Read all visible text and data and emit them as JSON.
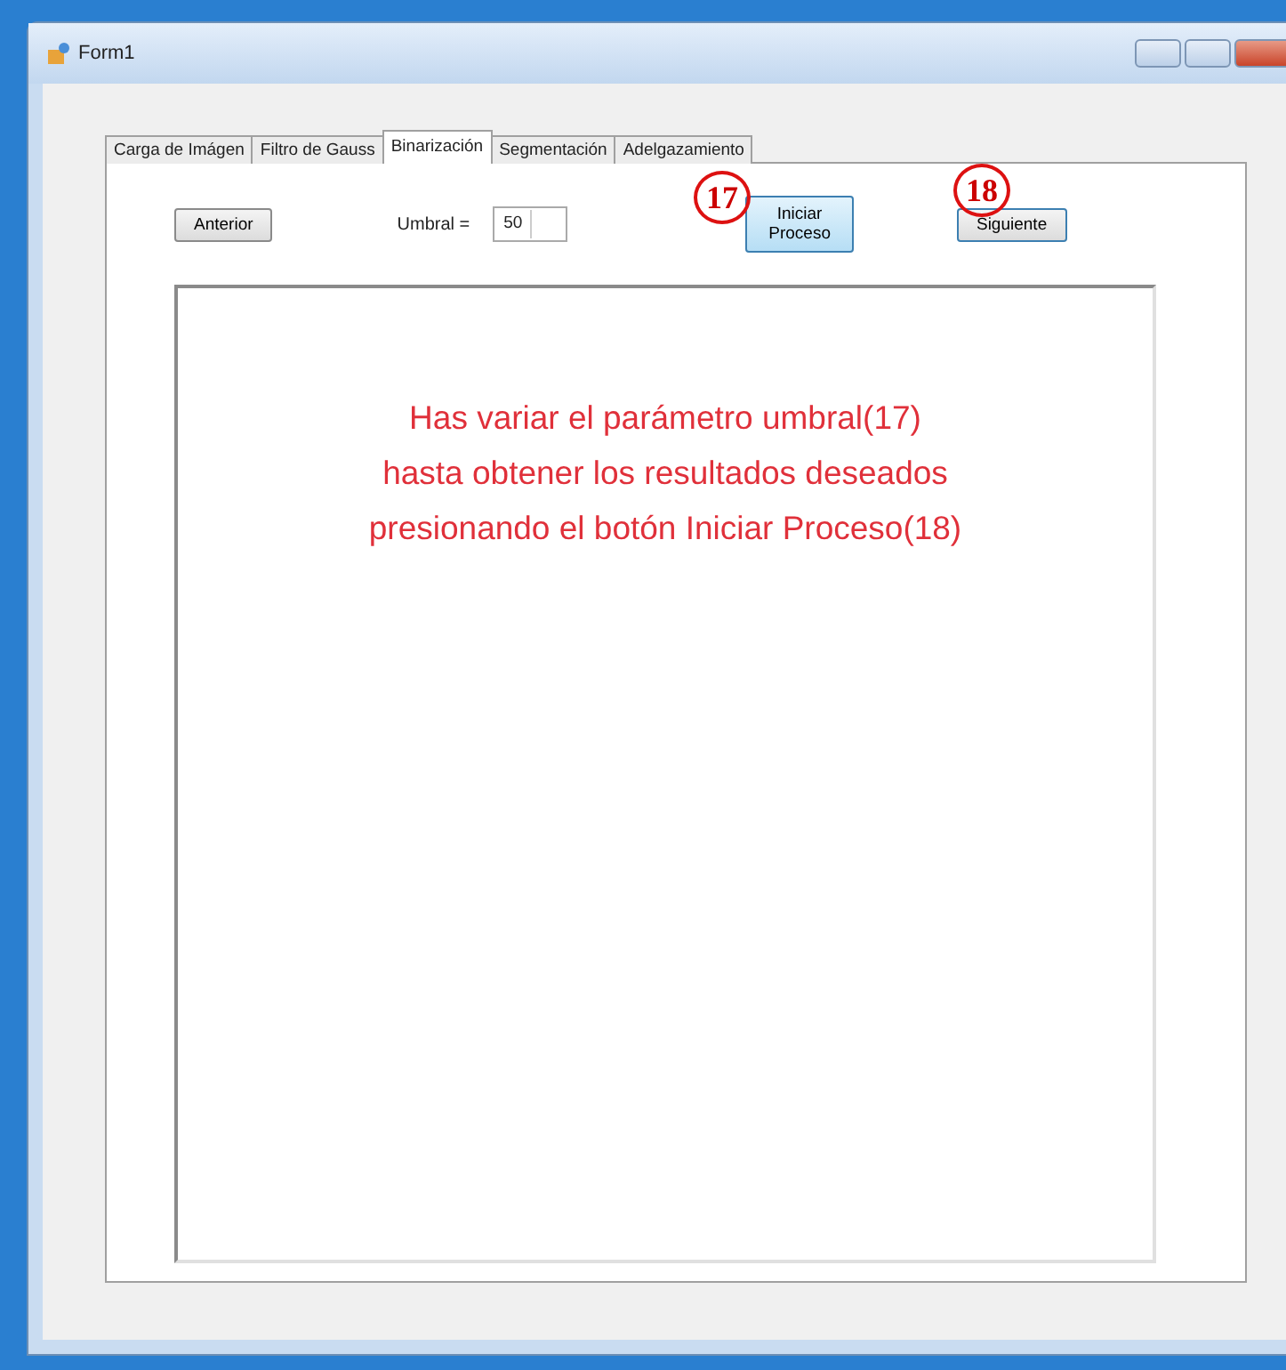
{
  "window": {
    "title": "Form1"
  },
  "tabs": [
    {
      "label": "Carga de Imágen",
      "selected": false
    },
    {
      "label": "Filtro de Gauss",
      "selected": false
    },
    {
      "label": "Binarización",
      "selected": true
    },
    {
      "label": "Segmentación",
      "selected": false
    },
    {
      "label": "Adelgazamiento",
      "selected": false
    }
  ],
  "toolbar": {
    "previous_button": "Anterior",
    "threshold_label": "Umbral =",
    "threshold_value": "50",
    "start_button": [
      "Iniciar",
      "Proceso"
    ],
    "next_button": "Siguiente"
  },
  "annotations": [
    {
      "label": "17"
    },
    {
      "label": "18"
    }
  ],
  "instruction": [
    "Has variar el parámetro umbral(17)",
    "hasta obtener  los resultados deseados",
    "presionando el botón Iniciar Proceso(18)"
  ]
}
